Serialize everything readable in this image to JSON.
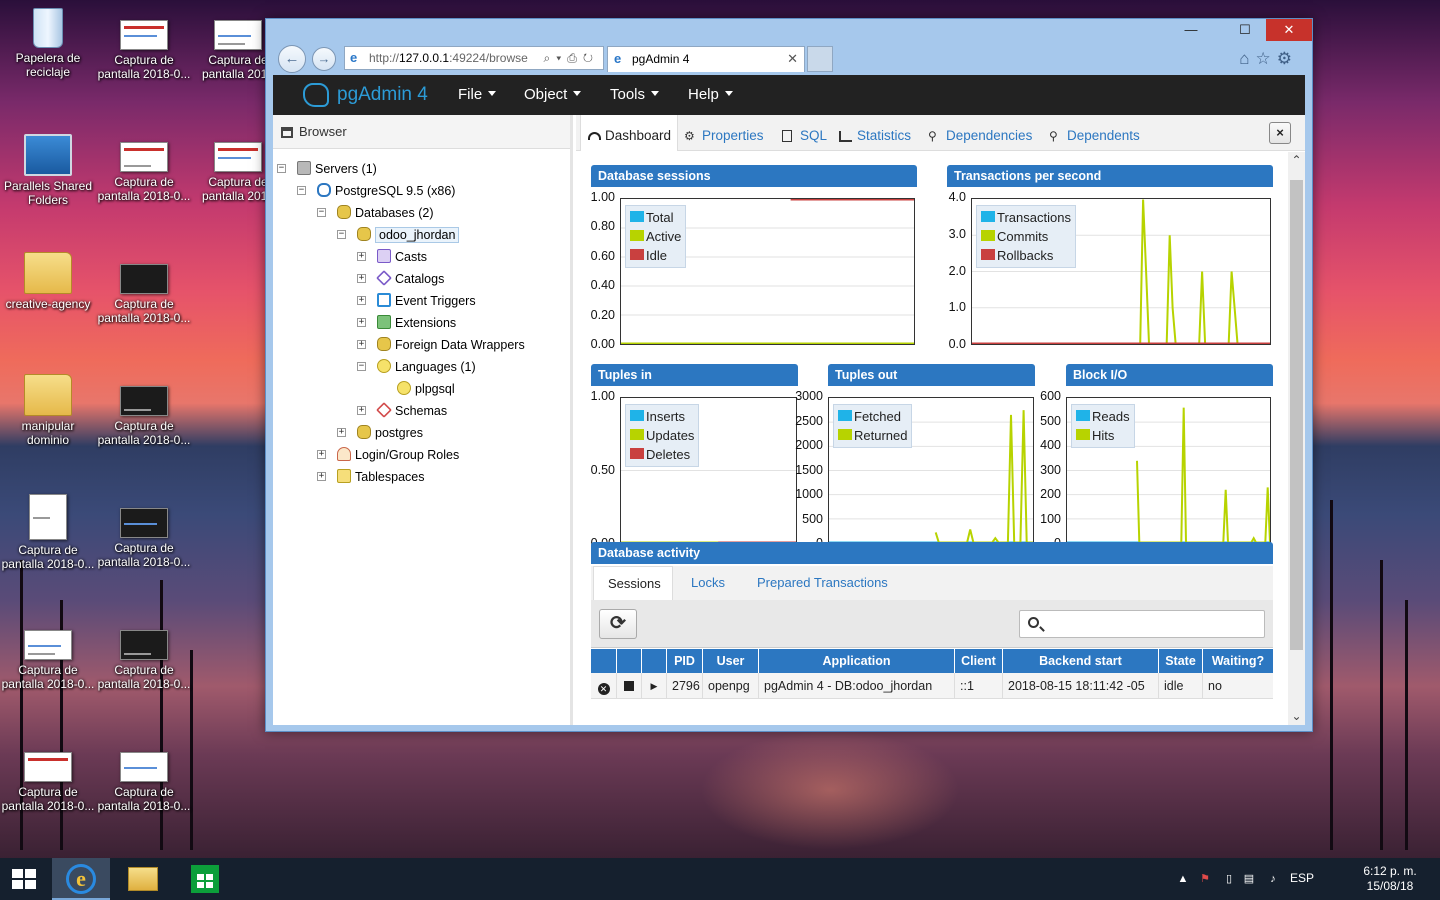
{
  "desktop": {
    "icons": [
      {
        "label": "Papelera de reciclaje",
        "kind": "recycle-bin"
      },
      {
        "label": "Captura de pantalla 2018-0...",
        "kind": "screenshot"
      },
      {
        "label": "Captura de pantalla 2018",
        "kind": "screenshot"
      },
      {
        "label": "Parallels Shared Folders",
        "kind": "shared-folder"
      },
      {
        "label": "Captura de pantalla 2018-0...",
        "kind": "screenshot"
      },
      {
        "label": "Captura de pantalla 2018",
        "kind": "screenshot"
      },
      {
        "label": "creative-agency",
        "kind": "folder"
      },
      {
        "label": "Captura de pantalla 2018-0...",
        "kind": "screenshot"
      },
      {
        "label": "manipular dominio",
        "kind": "folder"
      },
      {
        "label": "Captura de pantalla 2018-0...",
        "kind": "screenshot"
      },
      {
        "label": "Captura de pantalla 2018-0...",
        "kind": "screenshot"
      },
      {
        "label": "Captura de pantalla 2018-0...",
        "kind": "screenshot"
      },
      {
        "label": "Captura de pantalla 2018-0...",
        "kind": "screenshot"
      },
      {
        "label": "Captura de pantalla 2018-0...",
        "kind": "screenshot"
      },
      {
        "label": "Captura de pantalla 2018-0...",
        "kind": "screenshot"
      },
      {
        "label": "Captura de pantalla 2018-0...",
        "kind": "screenshot"
      }
    ]
  },
  "taskbar": {
    "language": "ESP",
    "time": "6:12 p. m.",
    "date": "15/08/18"
  },
  "browser": {
    "url_prefix": "http://",
    "url_host": "127.0.0.1",
    "url_rest": ":49224/browse",
    "tab_title": "pgAdmin 4",
    "win_minimize": "—",
    "win_maximize": "☐",
    "win_close": "✕"
  },
  "pgadmin": {
    "brand": "pgAdmin 4",
    "menus": [
      "File",
      "Object",
      "Tools",
      "Help"
    ],
    "browser_title": "Browser",
    "tree": [
      {
        "label": "Servers (1)",
        "icon": "servers-icon"
      },
      {
        "label": "PostgreSQL 9.5 (x86)",
        "icon": "server-icon"
      },
      {
        "label": "Databases (2)",
        "icon": "databases-icon"
      },
      {
        "label": "odoo_jhordan",
        "icon": "database-icon"
      },
      {
        "label": "Casts",
        "icon": "casts-icon"
      },
      {
        "label": "Catalogs",
        "icon": "catalogs-icon"
      },
      {
        "label": "Event Triggers",
        "icon": "event-triggers-icon"
      },
      {
        "label": "Extensions",
        "icon": "extensions-icon"
      },
      {
        "label": "Foreign Data Wrappers",
        "icon": "fdw-icon"
      },
      {
        "label": "Languages (1)",
        "icon": "languages-icon"
      },
      {
        "label": "plpgsql",
        "icon": "language-icon"
      },
      {
        "label": "Schemas",
        "icon": "schemas-icon"
      },
      {
        "label": "postgres",
        "icon": "database-icon"
      },
      {
        "label": "Login/Group Roles",
        "icon": "roles-icon"
      },
      {
        "label": "Tablespaces",
        "icon": "tablespaces-icon"
      }
    ],
    "tabs": [
      "Dashboard",
      "Properties",
      "SQL",
      "Statistics",
      "Dependencies",
      "Dependents"
    ],
    "close_label": "×"
  },
  "dashboard": {
    "panels": {
      "sessions": "Database sessions",
      "tps": "Transactions per second",
      "tuples_in": "Tuples in",
      "tuples_out": "Tuples out",
      "block_io": "Block I/O",
      "activity": "Database activity"
    },
    "colors": {
      "blue": "#1fb3e8",
      "yellowgreen": "#b7d300",
      "red": "#c9403f",
      "accent": "#2c77c1"
    }
  },
  "chart_data": [
    {
      "type": "line",
      "title": "Database sessions",
      "ylim": [
        0,
        1
      ],
      "yticks": [
        "1.00",
        "0.80",
        "0.60",
        "0.40",
        "0.20",
        "0.00"
      ],
      "legend_placement": "top-left",
      "series": [
        {
          "name": "Total",
          "color": "#1fb3e8",
          "values": [
            0,
            0,
            0,
            0,
            0,
            0,
            0,
            0,
            0,
            0,
            0,
            0,
            0,
            0,
            0,
            0,
            0,
            0,
            0,
            0
          ]
        },
        {
          "name": "Active",
          "color": "#b7d300",
          "values": [
            0,
            0,
            0,
            0,
            0,
            0,
            0,
            0,
            0,
            0,
            0,
            0,
            0,
            0,
            0,
            0,
            0,
            0,
            0,
            0
          ]
        },
        {
          "name": "Idle",
          "color": "#c9403f",
          "values": [
            null,
            null,
            null,
            null,
            null,
            null,
            null,
            null,
            null,
            null,
            null,
            1,
            1,
            1,
            1,
            1,
            1,
            1,
            1,
            1
          ]
        }
      ]
    },
    {
      "type": "line",
      "title": "Transactions per second",
      "ylim": [
        0,
        4
      ],
      "yticks": [
        "4.0",
        "3.0",
        "2.0",
        "1.0",
        "0.0"
      ],
      "legend_placement": "top-left",
      "series": [
        {
          "name": "Transactions",
          "color": "#1fb3e8",
          "values": [
            0,
            0,
            0,
            0,
            0,
            0,
            0,
            0,
            0,
            0,
            0,
            0,
            0,
            0,
            0,
            0,
            0,
            0,
            0,
            0,
            0,
            0,
            0,
            0,
            0,
            0,
            0,
            0,
            0,
            0
          ]
        },
        {
          "name": "Commits",
          "color": "#b7d300",
          "values": [
            0,
            0,
            0,
            0,
            0,
            0,
            0,
            0,
            0,
            0,
            0,
            0,
            0,
            0,
            0,
            0,
            0,
            0,
            0,
            0,
            0,
            0,
            0,
            0,
            0,
            0,
            0,
            0,
            0,
            0,
            0,
            0,
            0,
            0,
            0,
            0,
            0,
            0,
            0,
            0,
            0,
            0,
            0,
            0,
            0,
            0,
            0,
            0,
            0,
            0,
            0,
            0,
            0,
            0,
            0,
            0,
            0,
            0,
            4.0,
            2.0,
            0,
            0,
            0,
            0,
            0,
            0,
            0,
            3.0,
            1.0,
            0,
            0,
            0,
            0,
            0,
            0,
            0,
            0,
            0,
            2.0,
            0,
            0,
            0,
            0,
            0,
            0,
            0,
            0,
            0,
            2.0,
            1.0,
            0,
            0,
            0,
            0,
            0,
            0,
            0,
            0,
            0,
            0,
            0,
            0
          ]
        },
        {
          "name": "Rollbacks",
          "color": "#c9403f",
          "values": [
            0,
            0,
            0,
            0,
            0,
            0,
            0,
            0,
            0,
            0,
            0,
            0,
            0,
            0,
            0,
            0,
            0,
            0,
            0,
            0,
            0,
            0,
            0,
            0,
            0,
            0,
            0,
            0,
            0,
            0
          ]
        }
      ]
    },
    {
      "type": "line",
      "title": "Tuples in",
      "ylim": [
        0,
        1
      ],
      "yticks": [
        "1.00",
        "0.50",
        "0.00"
      ],
      "legend_placement": "top-left",
      "series": [
        {
          "name": "Inserts",
          "color": "#1fb3e8",
          "values": [
            0,
            0,
            0,
            0,
            0,
            0,
            0,
            0,
            0,
            0
          ]
        },
        {
          "name": "Updates",
          "color": "#b7d300",
          "values": [
            0,
            0,
            0,
            0,
            0,
            0,
            0,
            0,
            0,
            0
          ]
        },
        {
          "name": "Deletes",
          "color": "#c9403f",
          "values": [
            null,
            null,
            null,
            null,
            null,
            0,
            0,
            0,
            0,
            0
          ]
        }
      ]
    },
    {
      "type": "line",
      "title": "Tuples out",
      "ylim": [
        0,
        3000
      ],
      "yticks": [
        "3000",
        "2500",
        "2000",
        "1500",
        "1000",
        "500",
        "0"
      ],
      "legend_placement": "top-left",
      "series": [
        {
          "name": "Fetched",
          "color": "#1fb3e8",
          "values": [
            0,
            0,
            0,
            0,
            0,
            0,
            0,
            0,
            0,
            0
          ]
        },
        {
          "name": "Returned",
          "color": "#b7d300",
          "values": [
            null,
            null,
            null,
            null,
            null,
            null,
            null,
            null,
            null,
            null,
            null,
            null,
            null,
            null,
            null,
            null,
            null,
            null,
            null,
            null,
            null,
            null,
            null,
            null,
            null,
            null,
            null,
            null,
            null,
            null,
            null,
            null,
            null,
            null,
            220,
            0,
            0,
            0,
            0,
            0,
            0,
            0,
            0,
            0,
            0,
            280,
            0,
            0,
            0,
            0,
            0,
            0,
            0,
            100,
            0,
            0,
            0,
            0,
            2650,
            0,
            0,
            0,
            2750,
            0,
            0,
            0
          ]
        }
      ]
    },
    {
      "type": "line",
      "title": "Block I/O",
      "ylim": [
        0,
        600
      ],
      "yticks": [
        "600",
        "500",
        "400",
        "300",
        "200",
        "100",
        "0"
      ],
      "legend_placement": "top-left",
      "series": [
        {
          "name": "Reads",
          "color": "#1fb3e8",
          "values": [
            0,
            0,
            0,
            0,
            0,
            0,
            0,
            0,
            0,
            0
          ]
        },
        {
          "name": "Hits",
          "color": "#b7d300",
          "values": [
            null,
            null,
            null,
            null,
            null,
            null,
            null,
            null,
            null,
            null,
            null,
            null,
            null,
            null,
            null,
            null,
            null,
            null,
            null,
            null,
            null,
            null,
            null,
            null,
            null,
            null,
            null,
            null,
            null,
            null,
            340,
            0,
            0,
            0,
            0,
            0,
            0,
            0,
            0,
            0,
            0,
            0,
            0,
            0,
            0,
            0,
            0,
            0,
            0,
            0,
            560,
            0,
            0,
            0,
            0,
            0,
            0,
            0,
            0,
            0,
            0,
            0,
            0,
            0,
            0,
            0,
            0,
            0,
            220,
            0,
            0,
            0,
            0,
            0,
            0,
            0,
            0,
            0,
            0,
            0,
            20,
            0,
            0,
            0,
            0,
            0,
            230,
            0
          ]
        }
      ]
    }
  ],
  "activity": {
    "tabs": [
      "Sessions",
      "Locks",
      "Prepared Transactions"
    ],
    "refresh_label": "⟳",
    "search_placeholder": "",
    "columns": [
      "",
      "",
      "",
      "PID",
      "User",
      "Application",
      "Client",
      "Backend start",
      "State",
      "Waiting?"
    ],
    "rows": [
      {
        "pid": "2796",
        "user": "openpg",
        "application": "pgAdmin 4 - DB:odoo_jhordan",
        "client": "::1",
        "backend_start": "2018-08-15 18:11:42 -05",
        "state": "idle",
        "waiting": "no"
      }
    ]
  }
}
